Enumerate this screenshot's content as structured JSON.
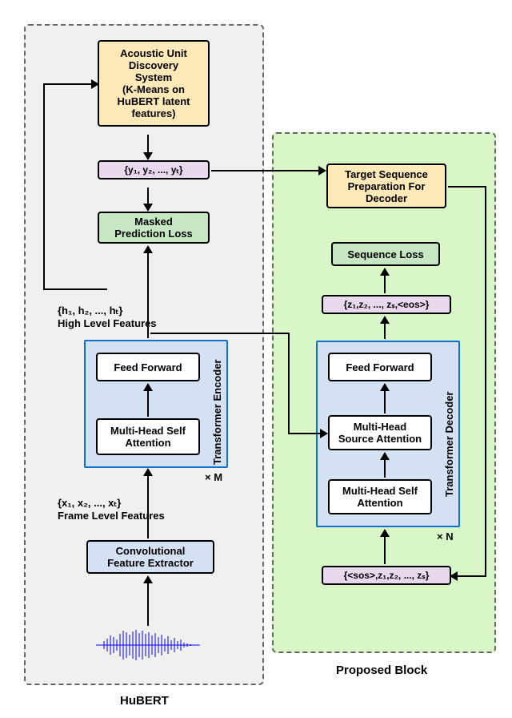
{
  "hubert": {
    "title": "HuBERT",
    "aud": "Acoustic Unit\nDiscovery\nSystem\n(K-Means on\nHuBERT latent\nfeatures)",
    "y_seq": "{y₁, y₂, ..., yₜ}",
    "loss": "Masked\nPrediction Loss",
    "h_seq": "{h₁, h₂, ..., hₜ}\nHigh Level Features",
    "encoder_label": "Transformer Encoder",
    "ff": "Feed Forward",
    "mhsa": "Multi-Head Self\nAttention",
    "times_m": "× M",
    "x_seq": "{x₁, x₂, ..., xₜ}\nFrame Level Features",
    "cfe": "Convolutional\nFeature Extractor"
  },
  "proposed": {
    "title": "Proposed Block",
    "target_prep": "Target Sequence\nPreparation For\nDecoder",
    "seq_loss": "Sequence Loss",
    "z_out": "{z₁,z₂, ..., zₛ,<eos>}",
    "decoder_label": "Transformer Decoder",
    "ff": "Feed Forward",
    "mhsource": "Multi-Head\nSource Attention",
    "mhsa": "Multi-Head Self\nAttention",
    "times_n": "× N",
    "z_in": "{<sos>,z₁,z₂, ..., zₛ}"
  }
}
